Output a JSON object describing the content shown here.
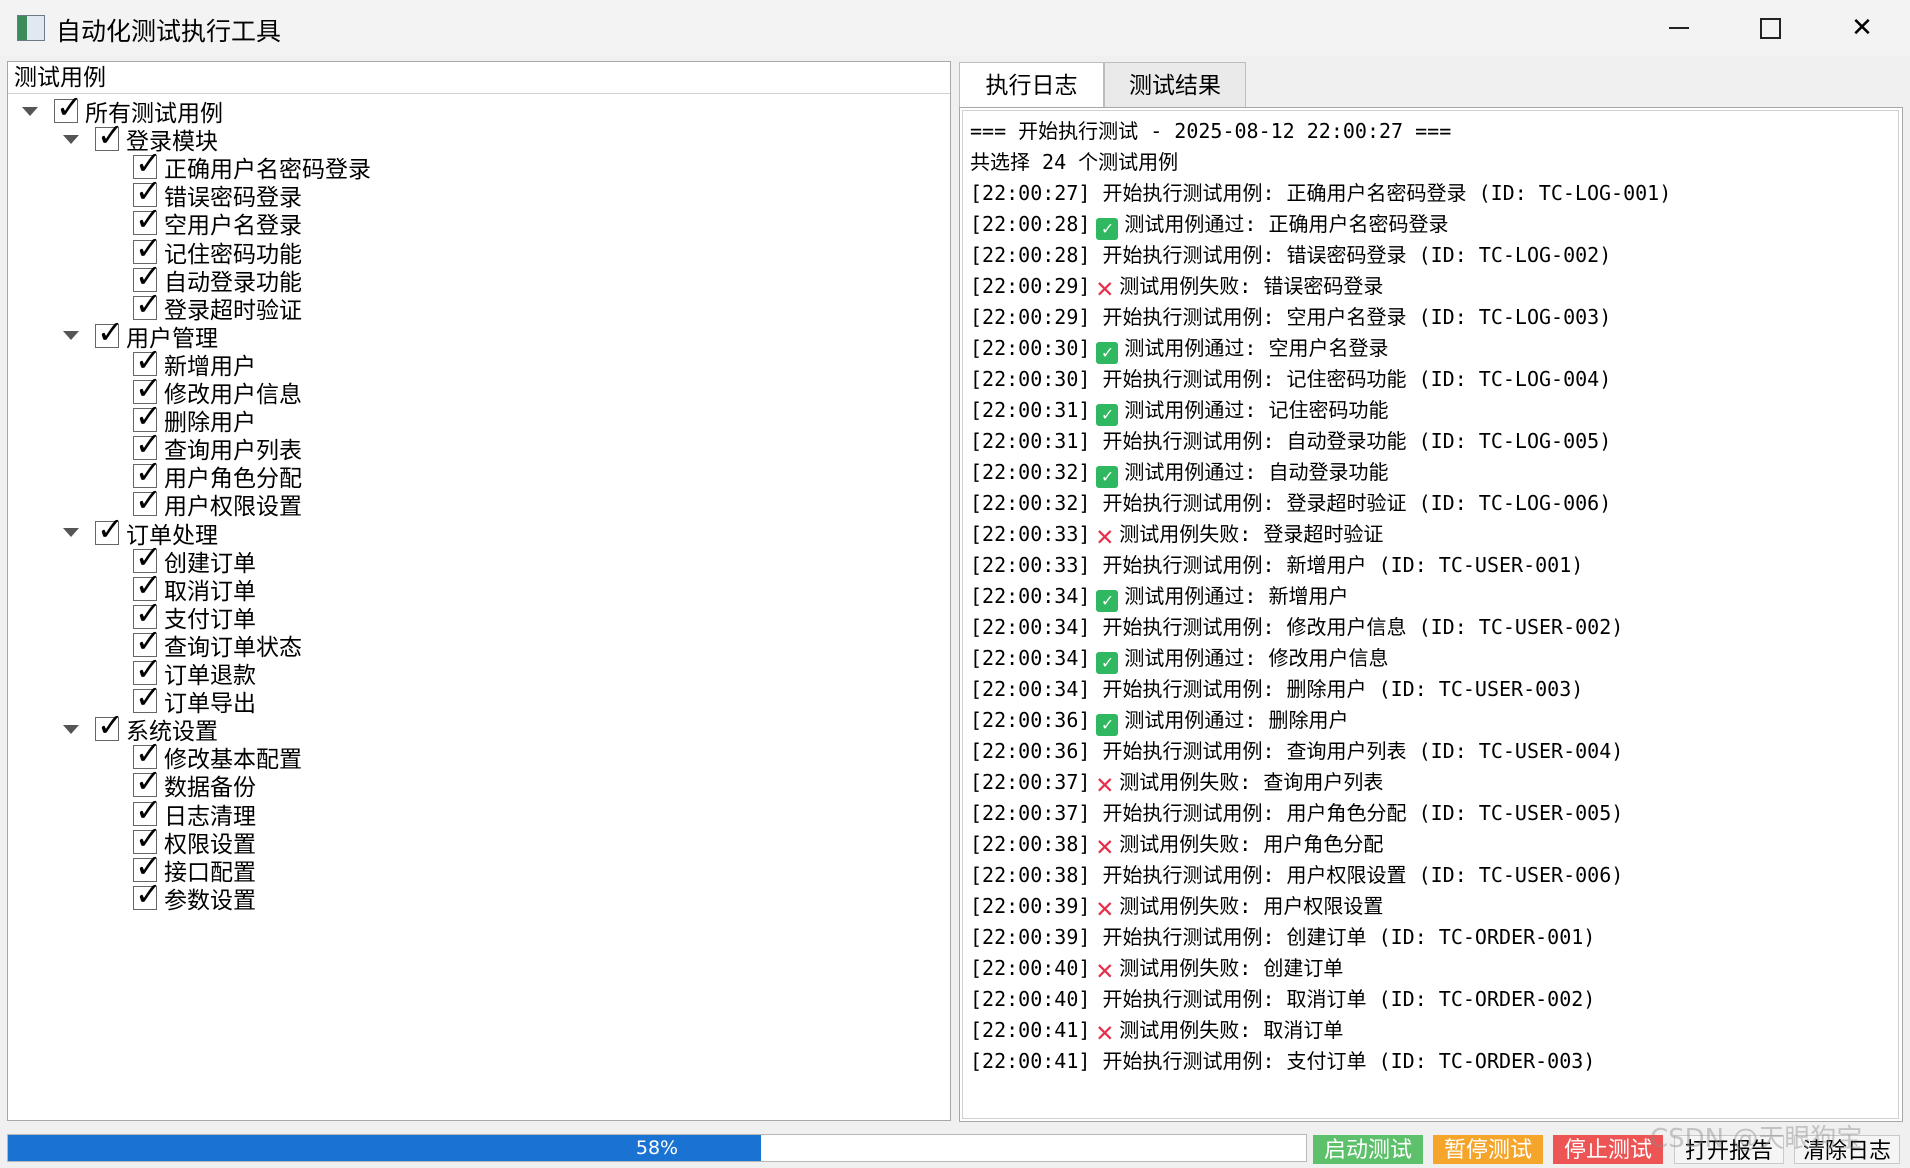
{
  "window": {
    "title": "自动化测试执行工具"
  },
  "tree": {
    "header": "测试用例",
    "root": "所有测试用例",
    "groups": [
      {
        "label": "登录模块",
        "items": [
          "正确用户名密码登录",
          "错误密码登录",
          "空用户名登录",
          "记住密码功能",
          "自动登录功能",
          "登录超时验证"
        ]
      },
      {
        "label": "用户管理",
        "items": [
          "新增用户",
          "修改用户信息",
          "删除用户",
          "查询用户列表",
          "用户角色分配",
          "用户权限设置"
        ]
      },
      {
        "label": "订单处理",
        "items": [
          "创建订单",
          "取消订单",
          "支付订单",
          "查询订单状态",
          "订单退款",
          "订单导出"
        ]
      },
      {
        "label": "系统设置",
        "items": [
          "修改基本配置",
          "数据备份",
          "日志清理",
          "权限设置",
          "接口配置",
          "参数设置"
        ]
      }
    ]
  },
  "tabs": [
    {
      "label": "执行日志",
      "active": true
    },
    {
      "label": "测试结果",
      "active": false
    }
  ],
  "log": [
    {
      "type": "plain",
      "text": "=== 开始执行测试 - 2025-08-12 22:00:27 ==="
    },
    {
      "type": "plain",
      "text": "共选择 24 个测试用例"
    },
    {
      "type": "plain",
      "text": "[22:00:27] 开始执行测试用例: 正确用户名密码登录 (ID: TC-LOG-001)"
    },
    {
      "type": "pass",
      "time": "[22:00:28]",
      "text": "测试用例通过: 正确用户名密码登录"
    },
    {
      "type": "plain",
      "text": "[22:00:28] 开始执行测试用例: 错误密码登录 (ID: TC-LOG-002)"
    },
    {
      "type": "fail",
      "time": "[22:00:29]",
      "text": "测试用例失败: 错误密码登录"
    },
    {
      "type": "plain",
      "text": "[22:00:29] 开始执行测试用例: 空用户名登录 (ID: TC-LOG-003)"
    },
    {
      "type": "pass",
      "time": "[22:00:30]",
      "text": "测试用例通过: 空用户名登录"
    },
    {
      "type": "plain",
      "text": "[22:00:30] 开始执行测试用例: 记住密码功能 (ID: TC-LOG-004)"
    },
    {
      "type": "pass",
      "time": "[22:00:31]",
      "text": "测试用例通过: 记住密码功能"
    },
    {
      "type": "plain",
      "text": "[22:00:31] 开始执行测试用例: 自动登录功能 (ID: TC-LOG-005)"
    },
    {
      "type": "pass",
      "time": "[22:00:32]",
      "text": "测试用例通过: 自动登录功能"
    },
    {
      "type": "plain",
      "text": "[22:00:32] 开始执行测试用例: 登录超时验证 (ID: TC-LOG-006)"
    },
    {
      "type": "fail",
      "time": "[22:00:33]",
      "text": "测试用例失败: 登录超时验证"
    },
    {
      "type": "plain",
      "text": "[22:00:33] 开始执行测试用例: 新增用户 (ID: TC-USER-001)"
    },
    {
      "type": "pass",
      "time": "[22:00:34]",
      "text": "测试用例通过: 新增用户"
    },
    {
      "type": "plain",
      "text": "[22:00:34] 开始执行测试用例: 修改用户信息 (ID: TC-USER-002)"
    },
    {
      "type": "pass",
      "time": "[22:00:34]",
      "text": "测试用例通过: 修改用户信息"
    },
    {
      "type": "plain",
      "text": "[22:00:34] 开始执行测试用例: 删除用户 (ID: TC-USER-003)"
    },
    {
      "type": "pass",
      "time": "[22:00:36]",
      "text": "测试用例通过: 删除用户"
    },
    {
      "type": "plain",
      "text": "[22:00:36] 开始执行测试用例: 查询用户列表 (ID: TC-USER-004)"
    },
    {
      "type": "fail",
      "time": "[22:00:37]",
      "text": "测试用例失败: 查询用户列表"
    },
    {
      "type": "plain",
      "text": "[22:00:37] 开始执行测试用例: 用户角色分配 (ID: TC-USER-005)"
    },
    {
      "type": "fail",
      "time": "[22:00:38]",
      "text": "测试用例失败: 用户角色分配"
    },
    {
      "type": "plain",
      "text": "[22:00:38] 开始执行测试用例: 用户权限设置 (ID: TC-USER-006)"
    },
    {
      "type": "fail",
      "time": "[22:00:39]",
      "text": "测试用例失败: 用户权限设置"
    },
    {
      "type": "plain",
      "text": "[22:00:39] 开始执行测试用例: 创建订单 (ID: TC-ORDER-001)"
    },
    {
      "type": "fail",
      "time": "[22:00:40]",
      "text": "测试用例失败: 创建订单"
    },
    {
      "type": "plain",
      "text": "[22:00:40] 开始执行测试用例: 取消订单 (ID: TC-ORDER-002)"
    },
    {
      "type": "fail",
      "time": "[22:00:41]",
      "text": "测试用例失败: 取消订单"
    },
    {
      "type": "plain",
      "text": "[22:00:41] 开始执行测试用例: 支付订单 (ID: TC-ORDER-003)"
    }
  ],
  "progress": {
    "value": 58,
    "label": "58%"
  },
  "buttons": {
    "start": "启动测试",
    "pause": "暂停测试",
    "stop": "停止测试",
    "report": "打开报告",
    "clear": "清除日志"
  },
  "watermark": "CSDN @天眼狗宝",
  "colors": {
    "progress": "#1a73d2",
    "start": "#5dc16b",
    "pause": "#f4a52a",
    "stop": "#ed5454",
    "pass": "#2fb85f",
    "fail": "#e5304b"
  }
}
